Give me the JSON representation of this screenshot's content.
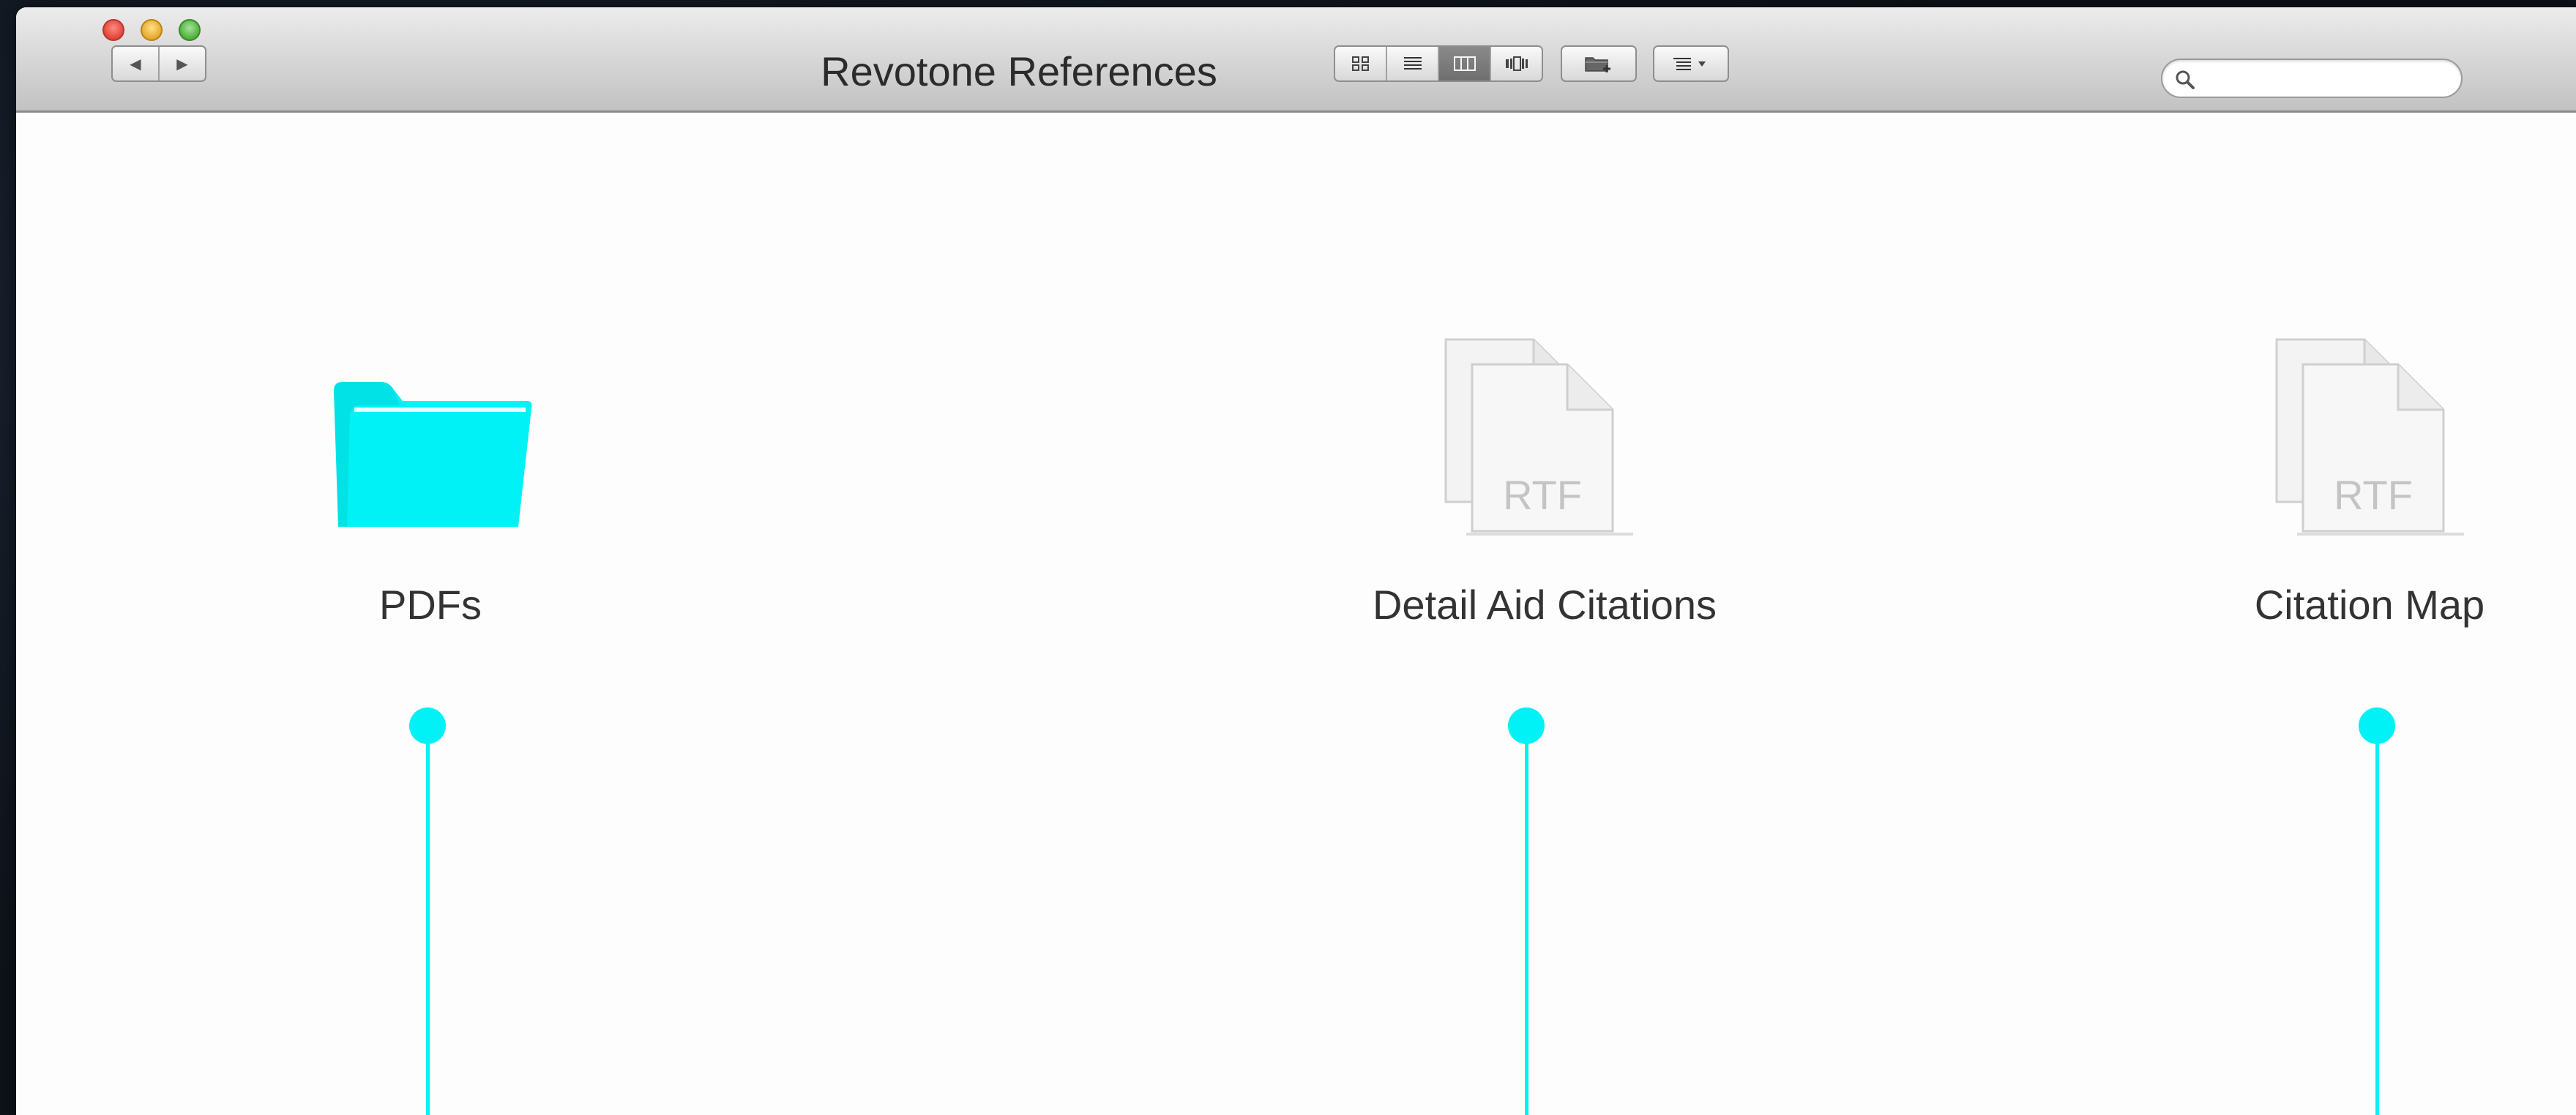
{
  "window": {
    "title": "Revotone References"
  },
  "toolbar": {
    "back_glyph": "◀",
    "forward_glyph": "▶",
    "views": [
      {
        "name": "icon-view",
        "icon": "icon-grid-icon",
        "active": false
      },
      {
        "name": "list-view",
        "icon": "list-lines-icon",
        "active": false
      },
      {
        "name": "column-view",
        "icon": "columns-icon",
        "active": true
      },
      {
        "name": "cover-flow-view",
        "icon": "coverflow-icon",
        "active": false
      }
    ],
    "new_folder_icon": "folder-plus-icon",
    "arrange_icon": "arrange-menu-icon"
  },
  "search": {
    "placeholder": "",
    "value": ""
  },
  "items": [
    {
      "label": "PDFs",
      "kind": "folder",
      "icon": "folder-icon",
      "color": "#00f2f6"
    },
    {
      "label": "Detail Aid Citations",
      "kind": "document",
      "icon": "rtf-document-icon",
      "badge": "RTF"
    },
    {
      "label": "Citation Map",
      "kind": "document",
      "icon": "rtf-document-icon",
      "badge": "RTF"
    }
  ],
  "colors": {
    "accent": "#00f2f6",
    "close": "#e0443a",
    "minimize": "#e5a92a",
    "maximize": "#50b03c"
  }
}
